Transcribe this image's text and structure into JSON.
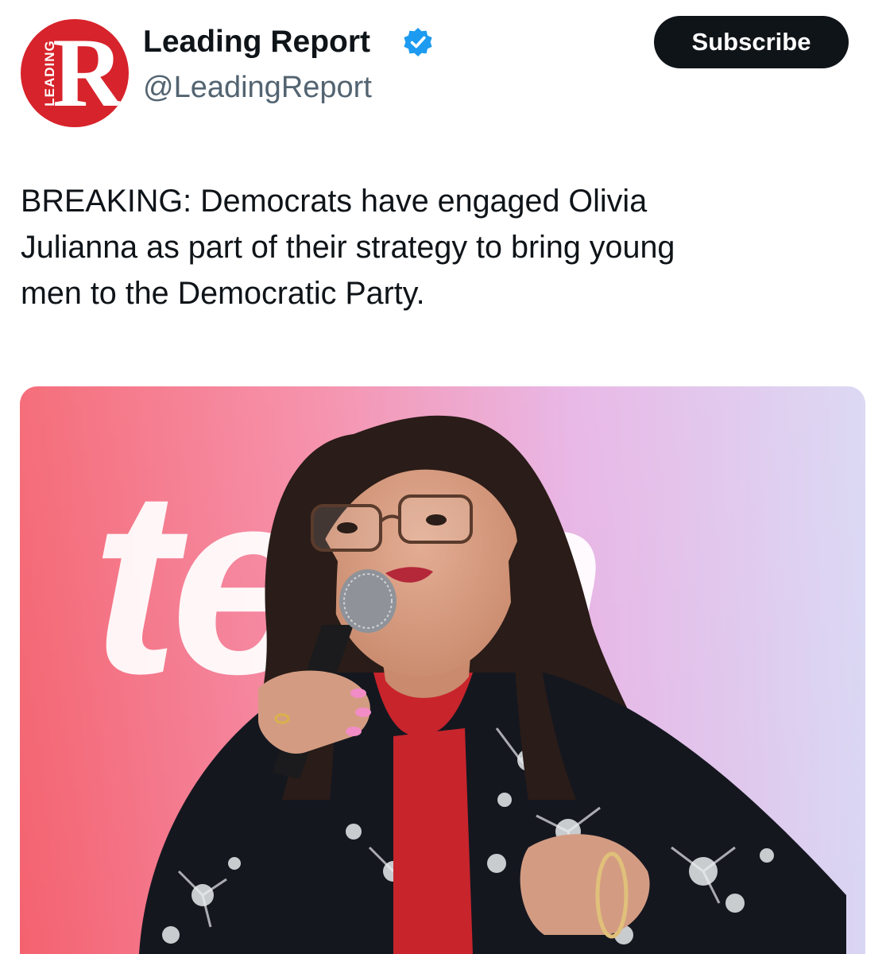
{
  "account": {
    "display_name": "Leading Report",
    "handle": "@LeadingReport",
    "verified": true,
    "avatar": {
      "letter": "R",
      "side_text": "LEADING",
      "color": "#d7232b"
    }
  },
  "actions": {
    "subscribe_label": "Subscribe"
  },
  "tweet": {
    "text_lines": [
      "BREAKING: Democrats have engaged Olivia",
      "Julianna as part of their strategy to bring young",
      "men to the Democratic Party."
    ]
  },
  "media": {
    "backdrop_text": "teen",
    "icon": "photo-of-speaker-with-microphone"
  },
  "colors": {
    "text_primary": "#0f1419",
    "text_secondary": "#536471",
    "verified_blue": "#1d9bf0",
    "button_bg": "#0f1419"
  }
}
